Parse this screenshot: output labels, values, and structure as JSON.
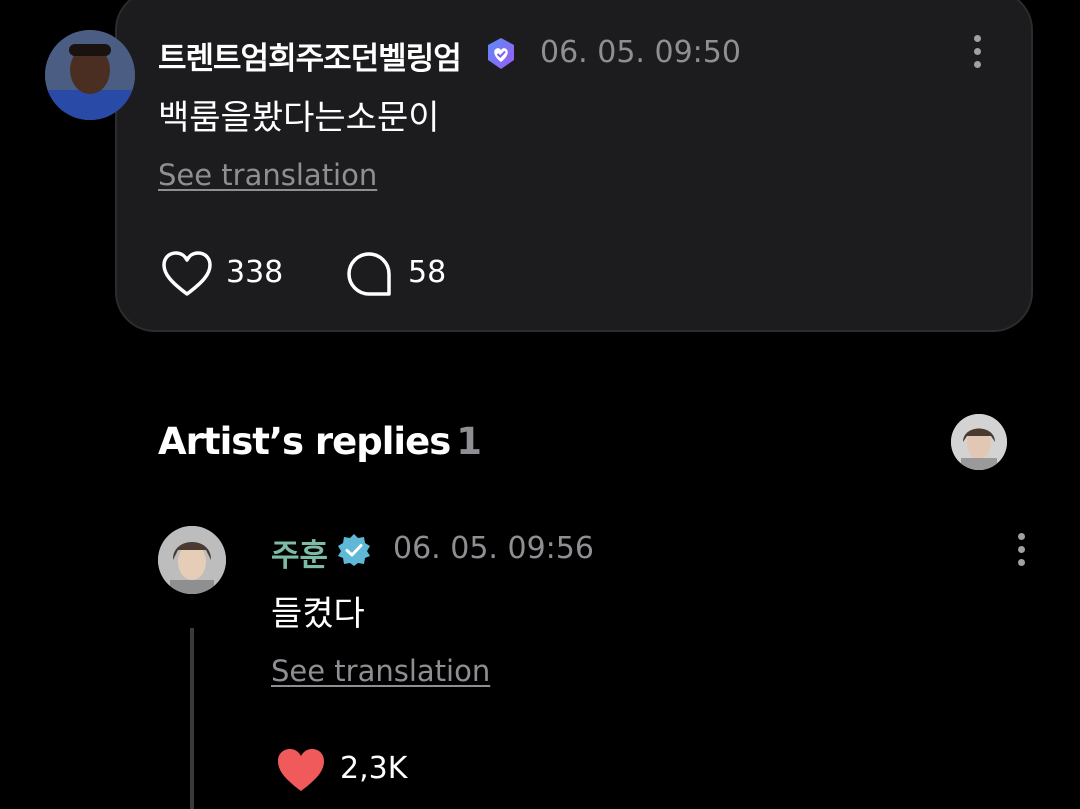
{
  "post": {
    "author": "트렌트엄희주조던벨링엄",
    "timestamp": "06. 05. 09:50",
    "text": "백룸을봤다는소문이",
    "see_translation": "See translation",
    "likes": "338",
    "comments": "58",
    "avatar_icon": "user-avatar",
    "badge_icon": "verified-heart-badge-icon",
    "badge_color": "#7b5cf5"
  },
  "replies": {
    "title": "Artist’s replies",
    "count": "1"
  },
  "artist_reply": {
    "author": "주훈",
    "timestamp": "06. 05. 09:56",
    "text": "들켰다",
    "see_translation": "See translation",
    "likes": "2,3K",
    "name_color": "#7dbba6",
    "badge_icon": "verified-check-badge-icon",
    "badge_color": "#5fb8d6",
    "heart_color": "#f05a5a"
  }
}
